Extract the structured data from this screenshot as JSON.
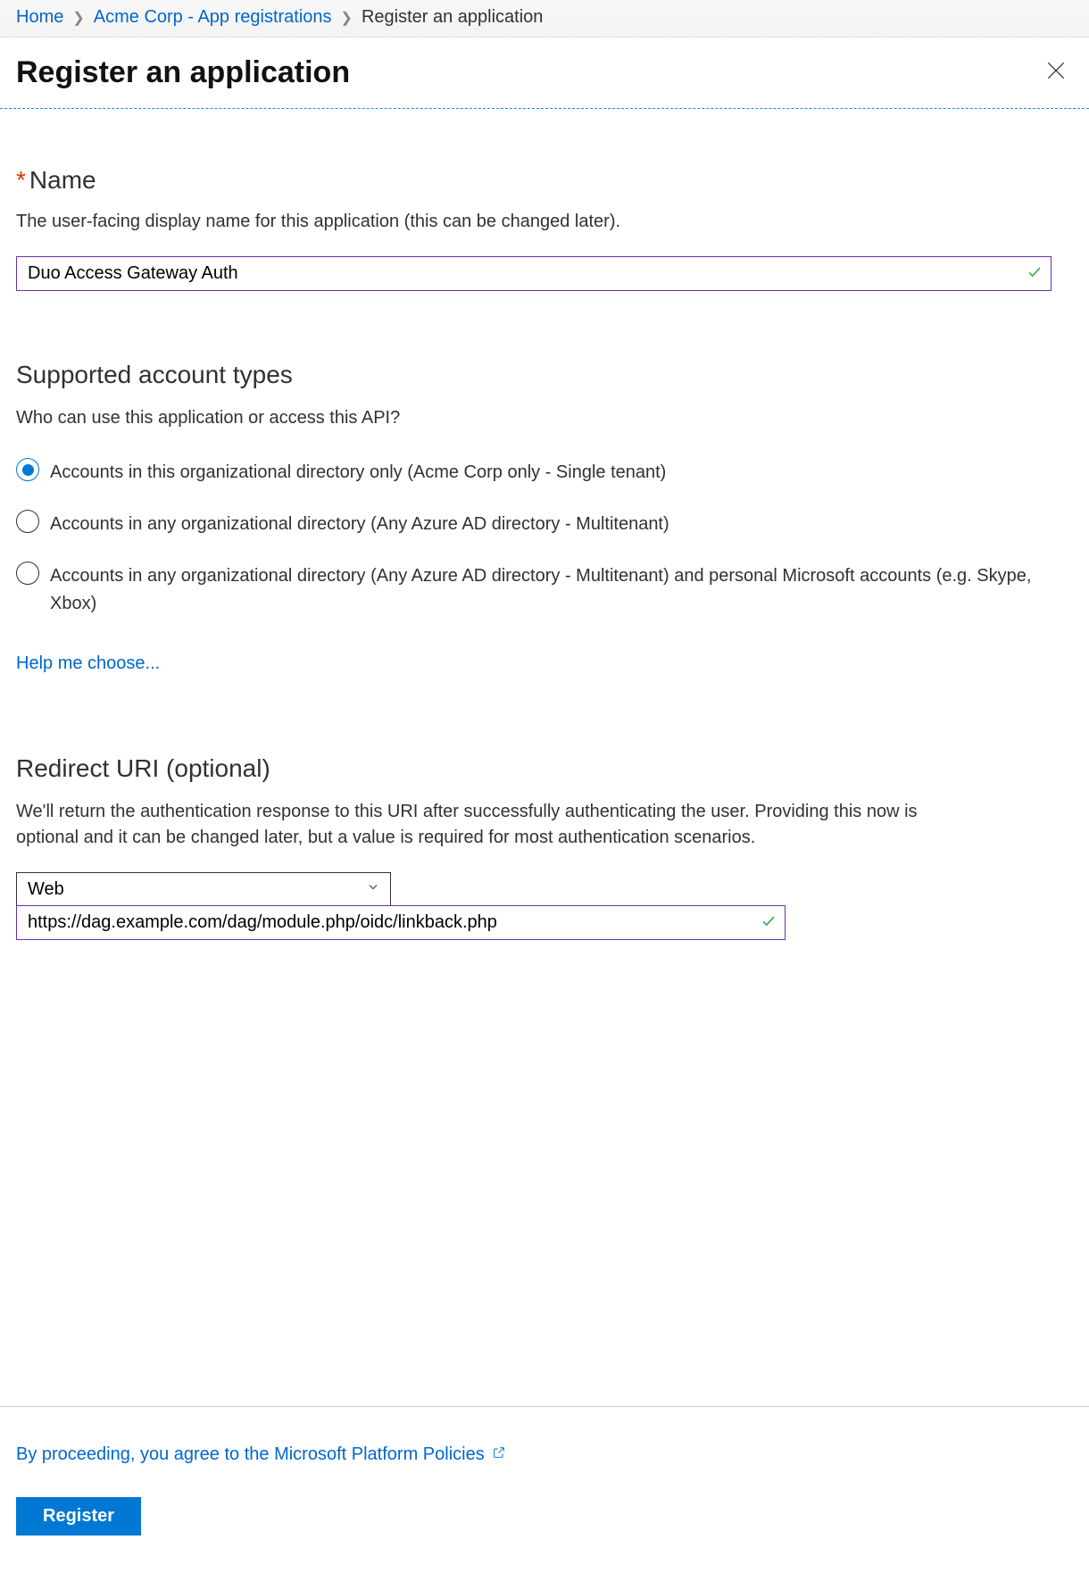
{
  "breadcrumb": {
    "home": "Home",
    "parent": "Acme Corp - App registrations",
    "current": "Register an application"
  },
  "title": "Register an application",
  "name_section": {
    "label": "Name",
    "description": "The user-facing display name for this application (this can be changed later).",
    "value": "Duo Access Gateway Auth"
  },
  "account_types": {
    "heading": "Supported account types",
    "description": "Who can use this application or access this API?",
    "options": [
      "Accounts in this organizational directory only (Acme Corp only - Single tenant)",
      "Accounts in any organizational directory (Any Azure AD directory - Multitenant)",
      "Accounts in any organizational directory (Any Azure AD directory - Multitenant) and personal Microsoft accounts (e.g. Skype, Xbox)"
    ],
    "selected_index": 0,
    "help_link": "Help me choose..."
  },
  "redirect": {
    "heading": "Redirect URI (optional)",
    "description": "We'll return the authentication response to this URI after successfully authenticating the user. Providing this now is optional and it can be changed later, but a value is required for most authentication scenarios.",
    "platform": "Web",
    "url": "https://dag.example.com/dag/module.php/oidc/linkback.php"
  },
  "footer": {
    "consent": "By proceeding, you agree to the Microsoft Platform Policies",
    "register_label": "Register"
  }
}
